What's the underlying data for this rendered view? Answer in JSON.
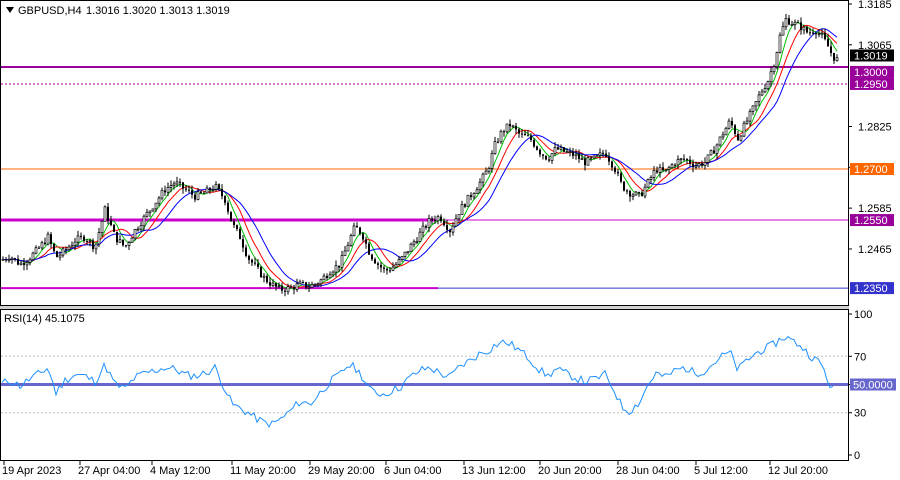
{
  "header": {
    "symbol": "GBPUSD,H4",
    "ohlc": "1.3016 1.3020 1.3013 1.3019"
  },
  "rsi_header": "RSI(14) 45.1075",
  "colors": {
    "candle": "#000000",
    "ma_fast": "#00c000",
    "ma_mid": "#ff0000",
    "ma_slow": "#0000ff",
    "rsi_line": "#1e90ff",
    "level_1_3000": "#990099",
    "level_1_2950": "#990099",
    "level_1_2700": "#ff6600",
    "level_1_2550": "#cc00cc",
    "level_1_2350": "#3333cc",
    "rsi_50": "#6666cc",
    "grid": "#c0c0c0"
  },
  "chart_data": [
    {
      "type": "candlestick",
      "title": "GBPUSD,H4",
      "ylim": [
        1.2315,
        1.3185
      ],
      "y_ticks": [
        "1.3185",
        "1.3065",
        "1.2825",
        "1.2705",
        "1.2585",
        "1.2465"
      ],
      "x_ticks": [
        "19 Apr 2023",
        "27 Apr 04:00",
        "4 May 12:00",
        "11 May 20:00",
        "29 May 20:00",
        "6 Jun 04:00",
        "13 Jun 12:00",
        "20 Jun 20:00",
        "28 Jun 04:00",
        "5 Jul 12:00",
        "12 Jul 20:00"
      ],
      "price_labels": [
        {
          "text": "1.3019",
          "value": 1.3019,
          "style": "current"
        },
        {
          "text": "1.3000",
          "value": 1.3,
          "style": "level"
        },
        {
          "text": "1.2950",
          "value": 1.295,
          "style": "level"
        },
        {
          "text": "1.2700",
          "value": 1.27,
          "style": "level_orange"
        },
        {
          "text": "1.2550",
          "value": 1.255,
          "style": "level"
        },
        {
          "text": "1.2350",
          "value": 1.235,
          "style": "level_blue"
        }
      ],
      "close_path": [
        [
          0,
          1.243
        ],
        [
          10,
          1.2445
        ],
        [
          20,
          1.242
        ],
        [
          30,
          1.244
        ],
        [
          40,
          1.247
        ],
        [
          48,
          1.25
        ],
        [
          56,
          1.244
        ],
        [
          65,
          1.246
        ],
        [
          75,
          1.249
        ],
        [
          85,
          1.25
        ],
        [
          95,
          1.247
        ],
        [
          105,
          1.258
        ],
        [
          115,
          1.25
        ],
        [
          125,
          1.247
        ],
        [
          135,
          1.252
        ],
        [
          145,
          1.256
        ],
        [
          155,
          1.26
        ],
        [
          165,
          1.264
        ],
        [
          175,
          1.266
        ],
        [
          185,
          1.264
        ],
        [
          195,
          1.262
        ],
        [
          205,
          1.263
        ],
        [
          215,
          1.265
        ],
        [
          225,
          1.261
        ],
        [
          232,
          1.254
        ],
        [
          240,
          1.25
        ],
        [
          248,
          1.244
        ],
        [
          256,
          1.241
        ],
        [
          264,
          1.238
        ],
        [
          272,
          1.236
        ],
        [
          280,
          1.2345
        ],
        [
          290,
          1.235
        ],
        [
          300,
          1.236
        ],
        [
          310,
          1.2355
        ],
        [
          320,
          1.237
        ],
        [
          330,
          1.24
        ],
        [
          340,
          1.242
        ],
        [
          348,
          1.248
        ],
        [
          355,
          1.253
        ],
        [
          362,
          1.251
        ],
        [
          370,
          1.245
        ],
        [
          378,
          1.242
        ],
        [
          385,
          1.24
        ],
        [
          392,
          1.241
        ],
        [
          400,
          1.243
        ],
        [
          410,
          1.247
        ],
        [
          420,
          1.251
        ],
        [
          430,
          1.255
        ],
        [
          440,
          1.256
        ],
        [
          450,
          1.252
        ],
        [
          460,
          1.258
        ],
        [
          470,
          1.262
        ],
        [
          480,
          1.266
        ],
        [
          488,
          1.27
        ],
        [
          495,
          1.277
        ],
        [
          502,
          1.281
        ],
        [
          510,
          1.283
        ],
        [
          520,
          1.28
        ],
        [
          530,
          1.279
        ],
        [
          540,
          1.275
        ],
        [
          548,
          1.273
        ],
        [
          556,
          1.276
        ],
        [
          565,
          1.275
        ],
        [
          575,
          1.274
        ],
        [
          585,
          1.272
        ],
        [
          595,
          1.273
        ],
        [
          605,
          1.275
        ],
        [
          615,
          1.27
        ],
        [
          622,
          1.265
        ],
        [
          630,
          1.263
        ],
        [
          640,
          1.262
        ],
        [
          648,
          1.266
        ],
        [
          656,
          1.27
        ],
        [
          665,
          1.269
        ],
        [
          675,
          1.272
        ],
        [
          685,
          1.273
        ],
        [
          695,
          1.271
        ],
        [
          705,
          1.272
        ],
        [
          715,
          1.276
        ],
        [
          722,
          1.28
        ],
        [
          730,
          1.284
        ],
        [
          738,
          1.279
        ],
        [
          745,
          1.283
        ],
        [
          752,
          1.287
        ],
        [
          760,
          1.292
        ],
        [
          768,
          1.296
        ],
        [
          775,
          1.302
        ],
        [
          780,
          1.309
        ],
        [
          786,
          1.314
        ],
        [
          792,
          1.313
        ],
        [
          800,
          1.312
        ],
        [
          808,
          1.31
        ],
        [
          815,
          1.311
        ],
        [
          822,
          1.309
        ],
        [
          828,
          1.306
        ],
        [
          833,
          1.303
        ],
        [
          838,
          1.3019
        ]
      ]
    },
    {
      "type": "line",
      "title": "RSI(14) 45.1075",
      "ylim": [
        0,
        100
      ],
      "y_ticks": [
        "100",
        "70",
        "50",
        "30",
        "0"
      ],
      "level_label": "50.0000",
      "levels": [
        70,
        50,
        30
      ],
      "values_path": [
        [
          0,
          50
        ],
        [
          10,
          53
        ],
        [
          20,
          49
        ],
        [
          30,
          54
        ],
        [
          40,
          58
        ],
        [
          48,
          62
        ],
        [
          56,
          44
        ],
        [
          65,
          53
        ],
        [
          75,
          57
        ],
        [
          85,
          56
        ],
        [
          95,
          52
        ],
        [
          105,
          64
        ],
        [
          115,
          50
        ],
        [
          125,
          47
        ],
        [
          135,
          55
        ],
        [
          145,
          58
        ],
        [
          155,
          60
        ],
        [
          165,
          62
        ],
        [
          175,
          61
        ],
        [
          185,
          57
        ],
        [
          195,
          56
        ],
        [
          205,
          58
        ],
        [
          215,
          62
        ],
        [
          225,
          47
        ],
        [
          232,
          36
        ],
        [
          240,
          33
        ],
        [
          248,
          30
        ],
        [
          256,
          26
        ],
        [
          264,
          23
        ],
        [
          272,
          22
        ],
        [
          280,
          25
        ],
        [
          290,
          31
        ],
        [
          300,
          38
        ],
        [
          310,
          36
        ],
        [
          320,
          44
        ],
        [
          330,
          52
        ],
        [
          340,
          57
        ],
        [
          348,
          64
        ],
        [
          355,
          62
        ],
        [
          362,
          56
        ],
        [
          370,
          46
        ],
        [
          378,
          44
        ],
        [
          385,
          43
        ],
        [
          392,
          46
        ],
        [
          400,
          48
        ],
        [
          410,
          55
        ],
        [
          420,
          60
        ],
        [
          430,
          62
        ],
        [
          440,
          58
        ],
        [
          450,
          55
        ],
        [
          460,
          63
        ],
        [
          470,
          67
        ],
        [
          480,
          72
        ],
        [
          488,
          74
        ],
        [
          495,
          78
        ],
        [
          502,
          80
        ],
        [
          510,
          79
        ],
        [
          520,
          74
        ],
        [
          530,
          68
        ],
        [
          540,
          60
        ],
        [
          548,
          56
        ],
        [
          556,
          61
        ],
        [
          565,
          58
        ],
        [
          575,
          55
        ],
        [
          585,
          52
        ],
        [
          595,
          54
        ],
        [
          605,
          57
        ],
        [
          615,
          45
        ],
        [
          622,
          34
        ],
        [
          630,
          31
        ],
        [
          640,
          38
        ],
        [
          648,
          50
        ],
        [
          656,
          58
        ],
        [
          665,
          55
        ],
        [
          675,
          60
        ],
        [
          685,
          62
        ],
        [
          695,
          58
        ],
        [
          705,
          60
        ],
        [
          715,
          66
        ],
        [
          722,
          70
        ],
        [
          730,
          73
        ],
        [
          738,
          60
        ],
        [
          745,
          66
        ],
        [
          752,
          70
        ],
        [
          760,
          74
        ],
        [
          768,
          76
        ],
        [
          775,
          79
        ],
        [
          780,
          82
        ],
        [
          786,
          84
        ],
        [
          792,
          81
        ],
        [
          800,
          78
        ],
        [
          808,
          72
        ],
        [
          815,
          68
        ],
        [
          822,
          64
        ],
        [
          828,
          52
        ],
        [
          833,
          47
        ],
        [
          838,
          45
        ]
      ]
    }
  ]
}
